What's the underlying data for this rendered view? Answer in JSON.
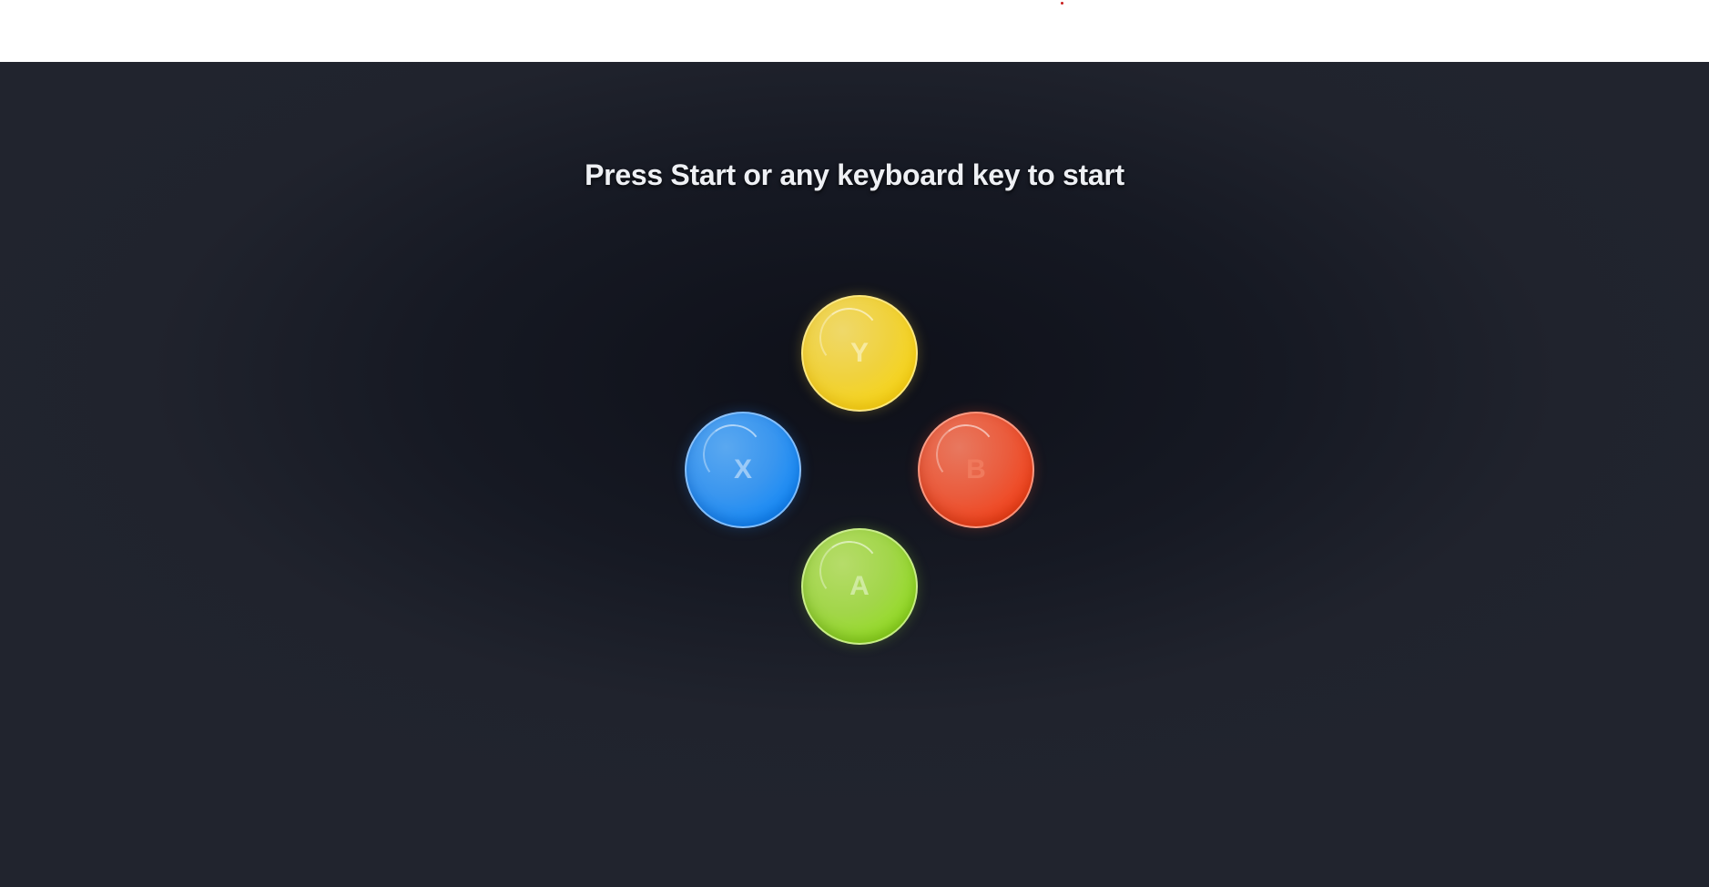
{
  "prompt": "Press Start or any keyboard key to start",
  "buttons": {
    "y": {
      "label": "Y",
      "color": "#f7d516"
    },
    "x": {
      "label": "X",
      "color": "#1389f6"
    },
    "b": {
      "label": "B",
      "color": "#f2421a"
    },
    "a": {
      "label": "A",
      "color": "#93dc22"
    }
  },
  "colors": {
    "background": "#161923",
    "topbar": "#ffffff",
    "text": "#eef0f4"
  }
}
